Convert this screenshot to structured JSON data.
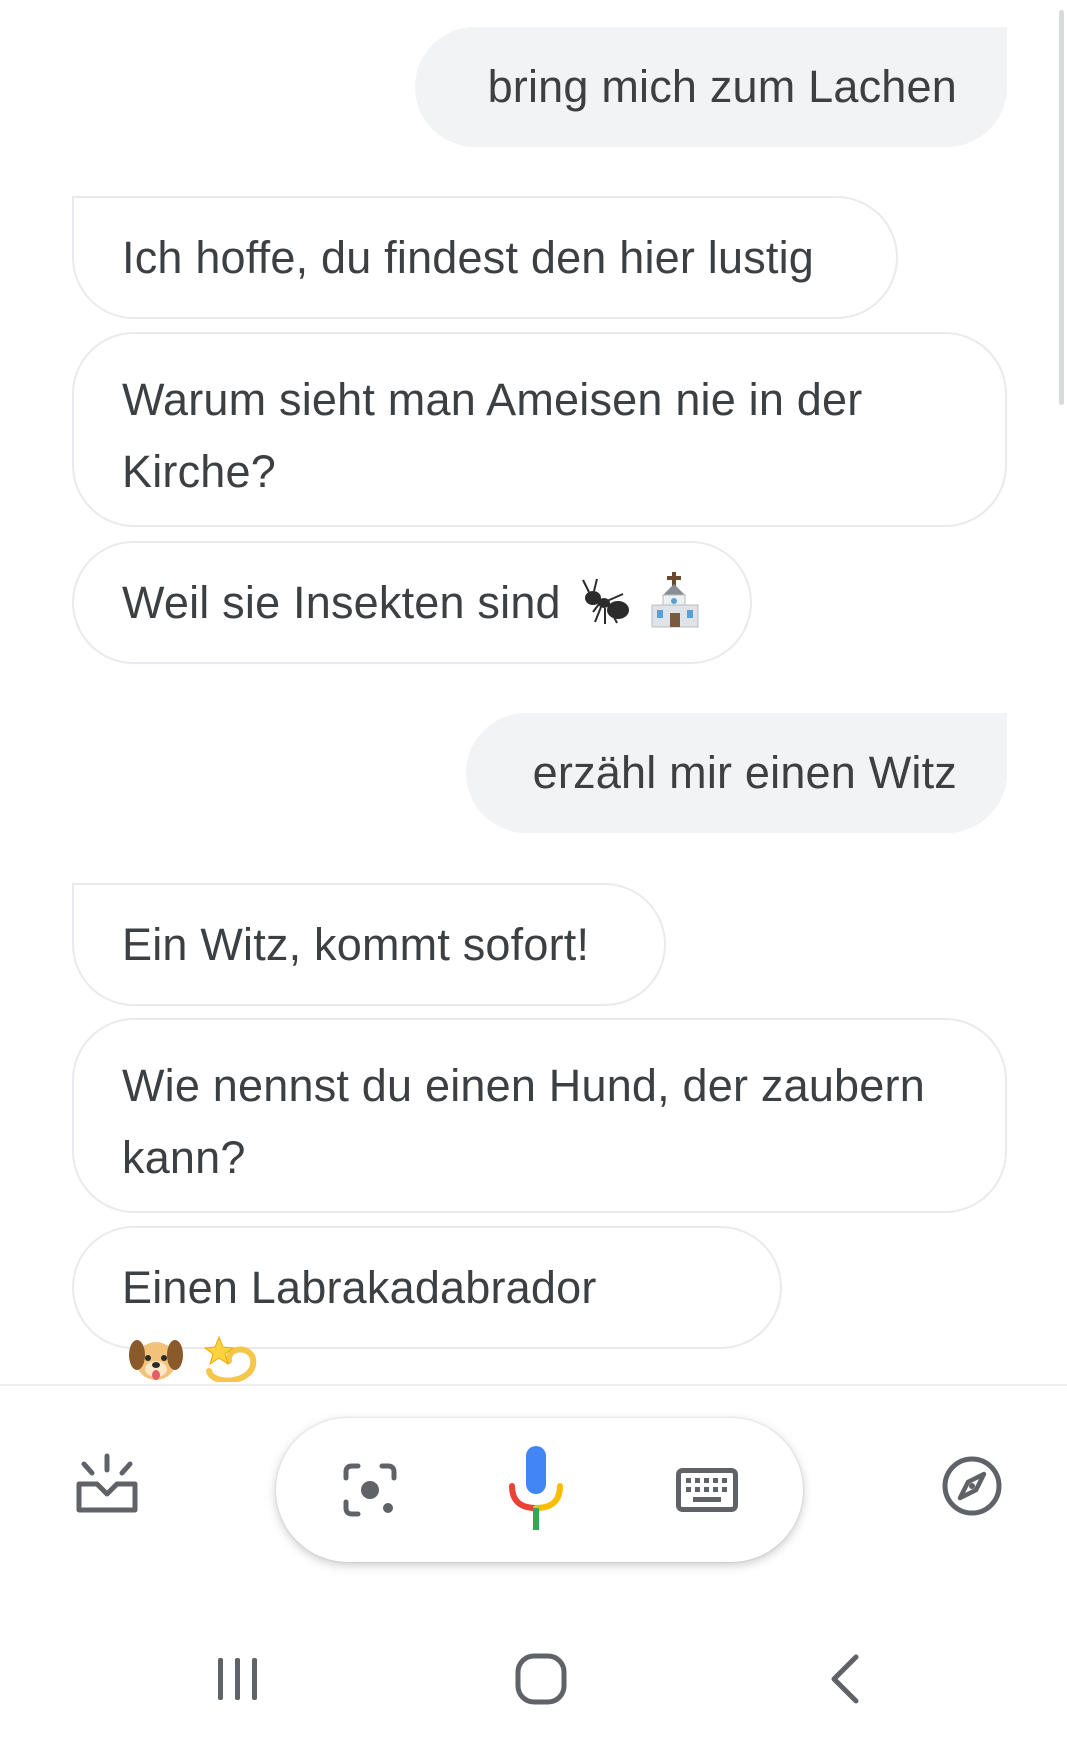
{
  "conversation": [
    {
      "role": "user",
      "text": "bring mich zum Lachen"
    },
    {
      "role": "assistant",
      "text": "Ich hoffe, du findest den hier lustig"
    },
    {
      "role": "assistant",
      "text": "Warum sieht man Ameisen nie in der Kirche?"
    },
    {
      "role": "assistant",
      "text": "Weil sie Insekten sind",
      "emojis": [
        "ant-emoji",
        "church-emoji"
      ]
    },
    {
      "role": "user",
      "text": "erzähl mir einen Witz"
    },
    {
      "role": "assistant",
      "text": "Ein Witz, kommt sofort!"
    },
    {
      "role": "assistant",
      "text": "Wie nennst du einen Hund, der zaubern kann?"
    },
    {
      "role": "assistant",
      "text": "Einen Labrakadabrador",
      "emojis": [
        "dog-face-emoji",
        "dizzy-emoji"
      ]
    }
  ],
  "assistant_bar": {
    "left_icon": "snapshot-icon",
    "pill_icons": [
      "lens-icon",
      "microphone-icon",
      "keyboard-icon"
    ],
    "right_icon": "compass-icon",
    "mic_colors": [
      "#4285f4",
      "#ea4335",
      "#fbbc05",
      "#34a853"
    ]
  },
  "nav_bar": {
    "icons": [
      "recent-apps-icon",
      "home-icon",
      "back-icon"
    ]
  }
}
